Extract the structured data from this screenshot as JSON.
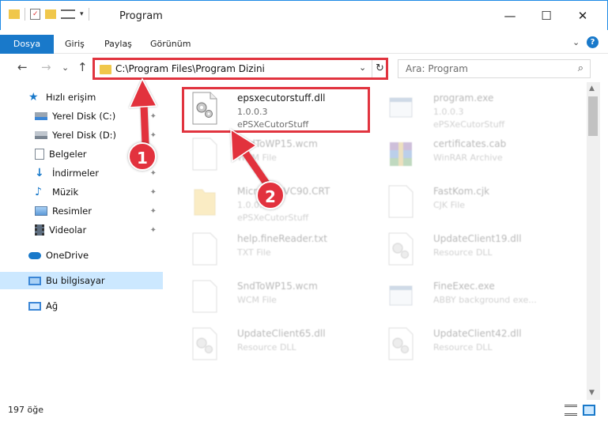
{
  "window": {
    "title": "Program",
    "minimize": "—",
    "maximize": "☐",
    "close": "✕"
  },
  "ribbon": {
    "tabs": [
      "Dosya",
      "Giriş",
      "Paylaş",
      "Görünüm"
    ],
    "collapse": "⌄",
    "help": "?"
  },
  "address": {
    "back": "←",
    "forward": "→",
    "recent": "⌄",
    "up": "↑",
    "path": "C:\\Program Files\\Program Dizini",
    "dropdown": "⌄",
    "refresh": "↻"
  },
  "search": {
    "placeholder": "Ara: Program",
    "icon": "⌕"
  },
  "sidebar": {
    "items": [
      {
        "label": "Hızlı erişim",
        "icon": "star-icon"
      },
      {
        "label": "Yerel Disk (C:)",
        "icon": "drive-icon",
        "pinned": true
      },
      {
        "label": "Yerel Disk (D:)",
        "icon": "drive-icon",
        "pinned": true
      },
      {
        "label": "Belgeler",
        "icon": "documents-icon",
        "pinned": true
      },
      {
        "label": "İndirmeler",
        "icon": "download-icon",
        "pinned": true
      },
      {
        "label": "Müzik",
        "icon": "music-icon",
        "pinned": true
      },
      {
        "label": "Resimler",
        "icon": "pictures-icon",
        "pinned": true
      },
      {
        "label": "Videolar",
        "icon": "videos-icon",
        "pinned": true
      },
      {
        "label": "OneDrive",
        "icon": "cloud-icon"
      },
      {
        "label": "Bu bilgisayar",
        "icon": "computer-icon",
        "selected": true
      },
      {
        "label": "Ağ",
        "icon": "network-icon"
      }
    ],
    "pin_glyph": "📌"
  },
  "files": [
    {
      "name": "epsxecutorstuff.dll",
      "line2": "1.0.0.3",
      "line3": "ePSXeCutorStuff",
      "icon": "dll-gear-icon",
      "highlighted": true
    },
    {
      "name": "program.exe",
      "line2": "1.0.0.3",
      "line3": "ePSXeCutorStuff",
      "icon": "exe-icon"
    },
    {
      "name": "SndToWP15.wcm",
      "line2": "WCM File",
      "line3": "",
      "icon": "blank-file-icon"
    },
    {
      "name": "certificates.cab",
      "line2": "WinRAR Archive",
      "line3": "",
      "icon": "winrar-icon"
    },
    {
      "name": "Microsoft.VC90.CRT",
      "line2": "1.0.0.3",
      "line3": "ePSXeCutorStuff",
      "icon": "folder-icon"
    },
    {
      "name": "FastKom.cjk",
      "line2": "CJK File",
      "line3": "",
      "icon": "blank-file-icon"
    },
    {
      "name": "help.fineReader.txt",
      "line2": "TXT File",
      "line3": "",
      "icon": "blank-file-icon"
    },
    {
      "name": "UpdateClient19.dll",
      "line2": "Resource DLL",
      "line3": "",
      "icon": "dll-gear-icon"
    },
    {
      "name": "SndToWP15.wcm",
      "line2": "WCM File",
      "line3": "",
      "icon": "blank-file-icon"
    },
    {
      "name": "FineExec.exe",
      "line2": "ABBY background exe...",
      "line3": "",
      "icon": "exe-icon"
    },
    {
      "name": "UpdateClient65.dll",
      "line2": "Resource DLL",
      "line3": "",
      "icon": "dll-gear-icon"
    },
    {
      "name": "UpdateClient42.dll",
      "line2": "Resource DLL",
      "line3": "",
      "icon": "dll-gear-icon"
    }
  ],
  "status": {
    "count": "197 öğe"
  },
  "callouts": [
    "1",
    "2"
  ],
  "colors": {
    "accent": "#1979ca",
    "annotation_red": "#e1343f",
    "selected_bg": "#cce8ff",
    "folder_yellow": "#f0c74b"
  }
}
